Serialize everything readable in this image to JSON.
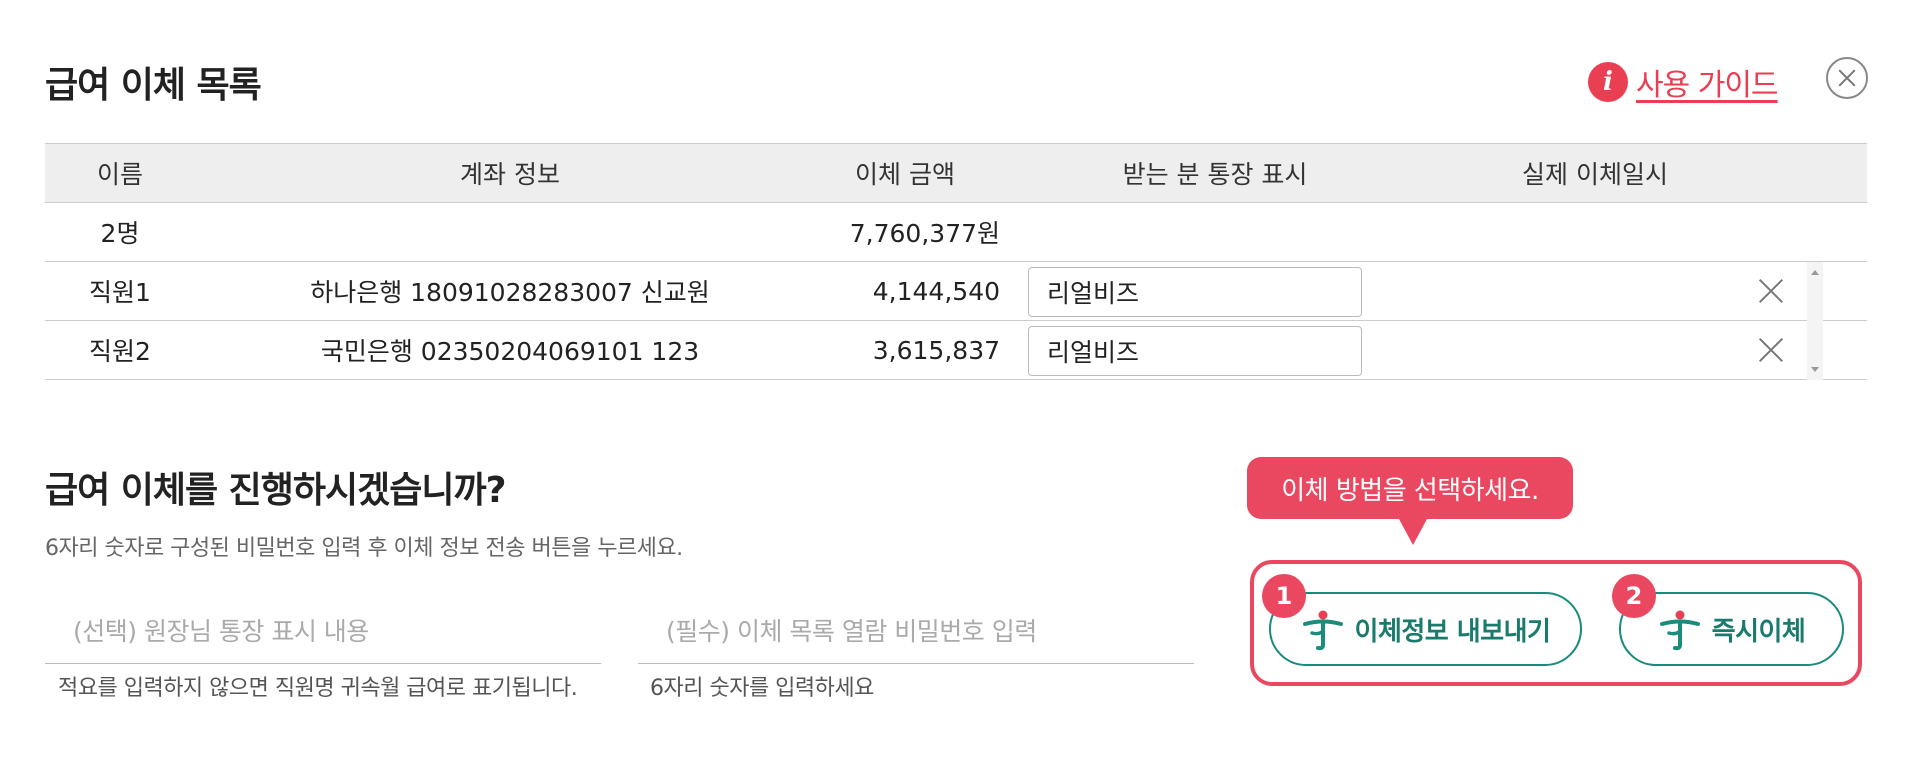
{
  "header": {
    "title": "급여 이체 목록",
    "guide_label": "사용 가이드"
  },
  "table": {
    "columns": [
      "이름",
      "계좌 정보",
      "이체 금액",
      "받는 분 통장 표시",
      "실제 이체일시"
    ],
    "summary": {
      "count": "2명",
      "total": "7,760,377원"
    },
    "rows": [
      {
        "name": "직원1",
        "account": "하나은행 18091028283007 신교원",
        "amount": "4,144,540",
        "memo": "리얼비즈",
        "date": ""
      },
      {
        "name": "직원2",
        "account": "국민은행 02350204069101 123",
        "amount": "3,615,837",
        "memo": "리얼비즈",
        "date": ""
      }
    ]
  },
  "confirm": {
    "title": "급여 이체를 진행하시겠습니까?",
    "description": "6자리 숫자로 구성된 비밀번호 입력 후 이체 정보 전송 버튼을 누르세요.",
    "memo_field": {
      "placeholder": "(선택) 원장님 통장 표시 내용",
      "value": "",
      "hint": "적요를 입력하지 않으면 직원명 귀속월 급여로 표기됩니다."
    },
    "password_field": {
      "placeholder": "(필수) 이체 목록 열람 비밀번호 입력",
      "value": "",
      "hint": "6자리 숫자를 입력하세요"
    }
  },
  "method": {
    "tooltip": "이체 방법을 선택하세요.",
    "options": [
      {
        "badge": "1",
        "label": "이체정보 내보내기",
        "icon": "hana-bank-icon"
      },
      {
        "badge": "2",
        "label": "즉시이체",
        "icon": "hana-bank-icon"
      }
    ]
  },
  "colors": {
    "accent": "#ea4860",
    "hana_green": "#1a8c7c",
    "header_bg": "#eeeeee"
  }
}
